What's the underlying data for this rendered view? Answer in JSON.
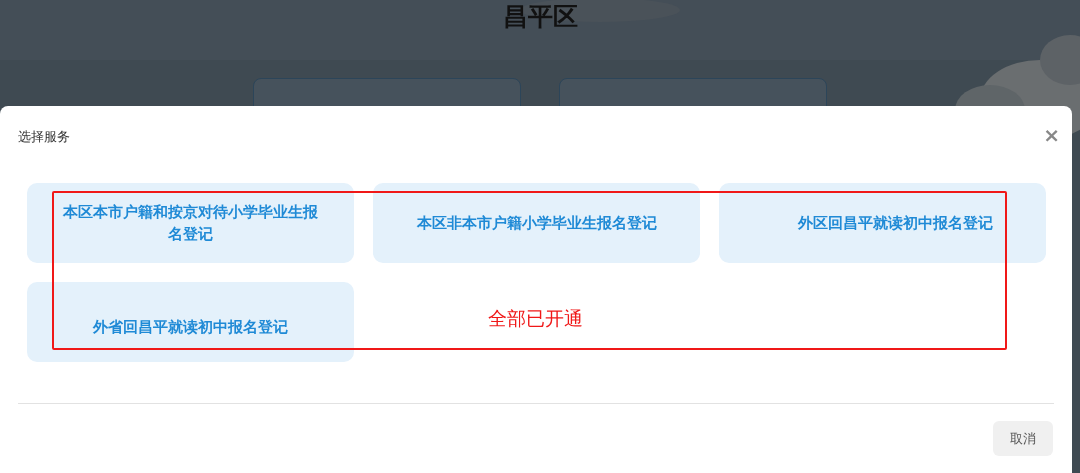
{
  "page": {
    "title": "昌平区"
  },
  "dialog": {
    "title": "选择服务",
    "close": "×",
    "services": [
      {
        "label": "本区本市户籍和按京对待小学毕业生报名登记"
      },
      {
        "label": "本区非本市户籍小学毕业生报名登记"
      },
      {
        "label": "外区回昌平就读初中报名登记"
      },
      {
        "label": "外省回昌平就读初中报名登记"
      }
    ],
    "annotation": "全部已开通",
    "buttons": [
      "取消"
    ]
  }
}
